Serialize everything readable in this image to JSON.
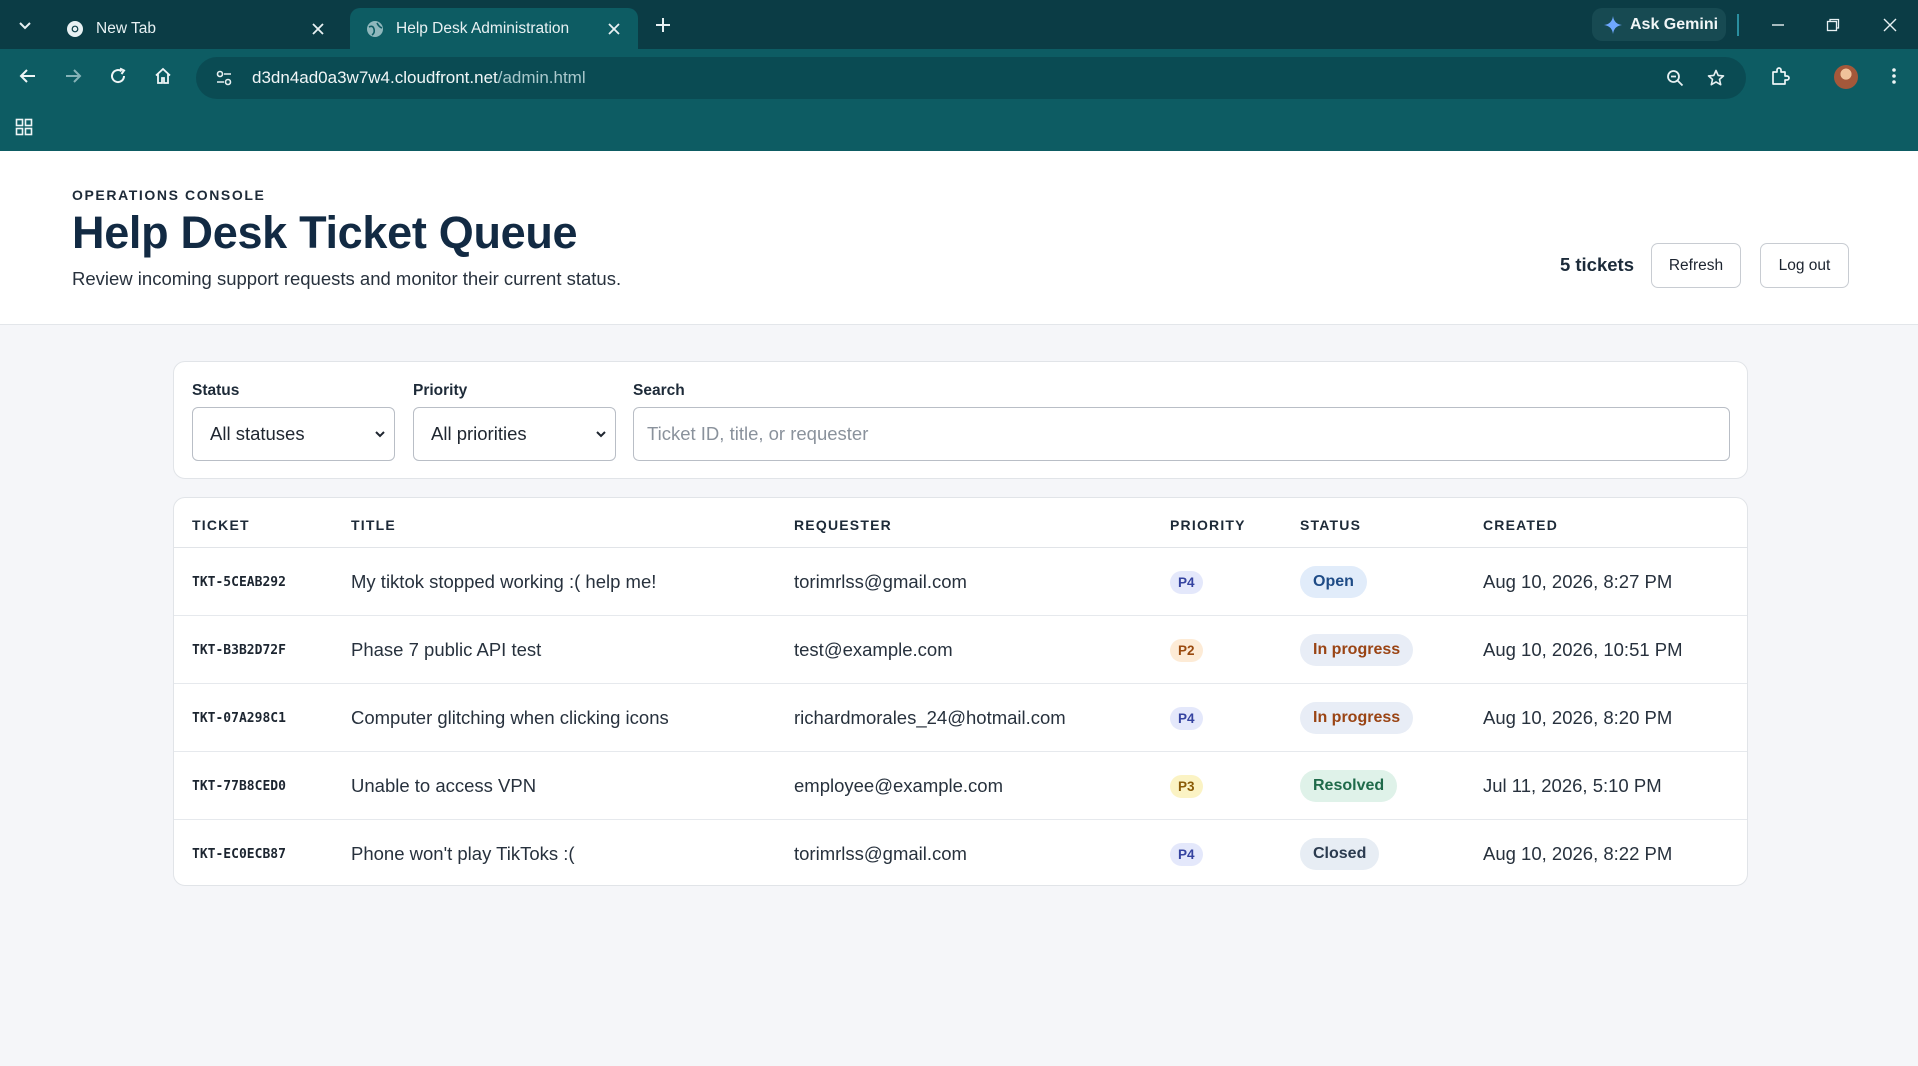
{
  "browser": {
    "tabs": [
      {
        "title": "New Tab",
        "active": false,
        "icon": "chrome-icon"
      },
      {
        "title": "Help Desk Administration",
        "active": true,
        "icon": "globe-icon"
      }
    ],
    "ask_gemini_label": "Ask Gemini",
    "url_host": "d3dn4ad0a3w7w4.cloudfront.net",
    "url_path": "/admin.html"
  },
  "header": {
    "eyebrow": "OPERATIONS CONSOLE",
    "title": "Help Desk Ticket Queue",
    "subtitle": "Review incoming support requests and monitor their current status.",
    "ticket_count": "5 tickets",
    "refresh_label": "Refresh",
    "logout_label": "Log out"
  },
  "filters": {
    "status_label": "Status",
    "status_value": "All statuses",
    "priority_label": "Priority",
    "priority_value": "All priorities",
    "search_label": "Search",
    "search_placeholder": "Ticket ID, title, or requester",
    "search_value": ""
  },
  "table": {
    "columns": [
      "TICKET",
      "TITLE",
      "REQUESTER",
      "PRIORITY",
      "STATUS",
      "CREATED"
    ],
    "rows": [
      {
        "id": "TKT-5CEAB292",
        "title": "My tiktok stopped working :( help me!",
        "requester": "torimrlss@gmail.com",
        "priority": "P4",
        "status": "Open",
        "status_key": "open",
        "created": "Aug 10, 2026, 8:27 PM"
      },
      {
        "id": "TKT-B3B2D72F",
        "title": "Phase 7 public API test",
        "requester": "test@example.com",
        "priority": "P2",
        "status": "In progress",
        "status_key": "inprogress",
        "created": "Aug 10, 2026, 10:51 PM"
      },
      {
        "id": "TKT-07A298C1",
        "title": "Computer glitching when clicking icons",
        "requester": "richardmorales_24@hotmail.com",
        "priority": "P4",
        "status": "In progress",
        "status_key": "inprogress",
        "created": "Aug 10, 2026, 8:20 PM"
      },
      {
        "id": "TKT-77B8CED0",
        "title": "Unable to access VPN",
        "requester": "employee@example.com",
        "priority": "P3",
        "status": "Resolved",
        "status_key": "resolved",
        "created": "Jul 11, 2026, 5:10 PM"
      },
      {
        "id": "TKT-EC0ECB87",
        "title": "Phone won't play TikToks :(",
        "requester": "torimrlss@gmail.com",
        "priority": "P4",
        "status": "Closed",
        "status_key": "closed",
        "created": "Aug 10, 2026, 8:22 PM"
      }
    ]
  },
  "colors": {
    "chrome_dark": "#0b3c45",
    "chrome_teal": "#0d5c63",
    "title_navy": "#122a43"
  }
}
